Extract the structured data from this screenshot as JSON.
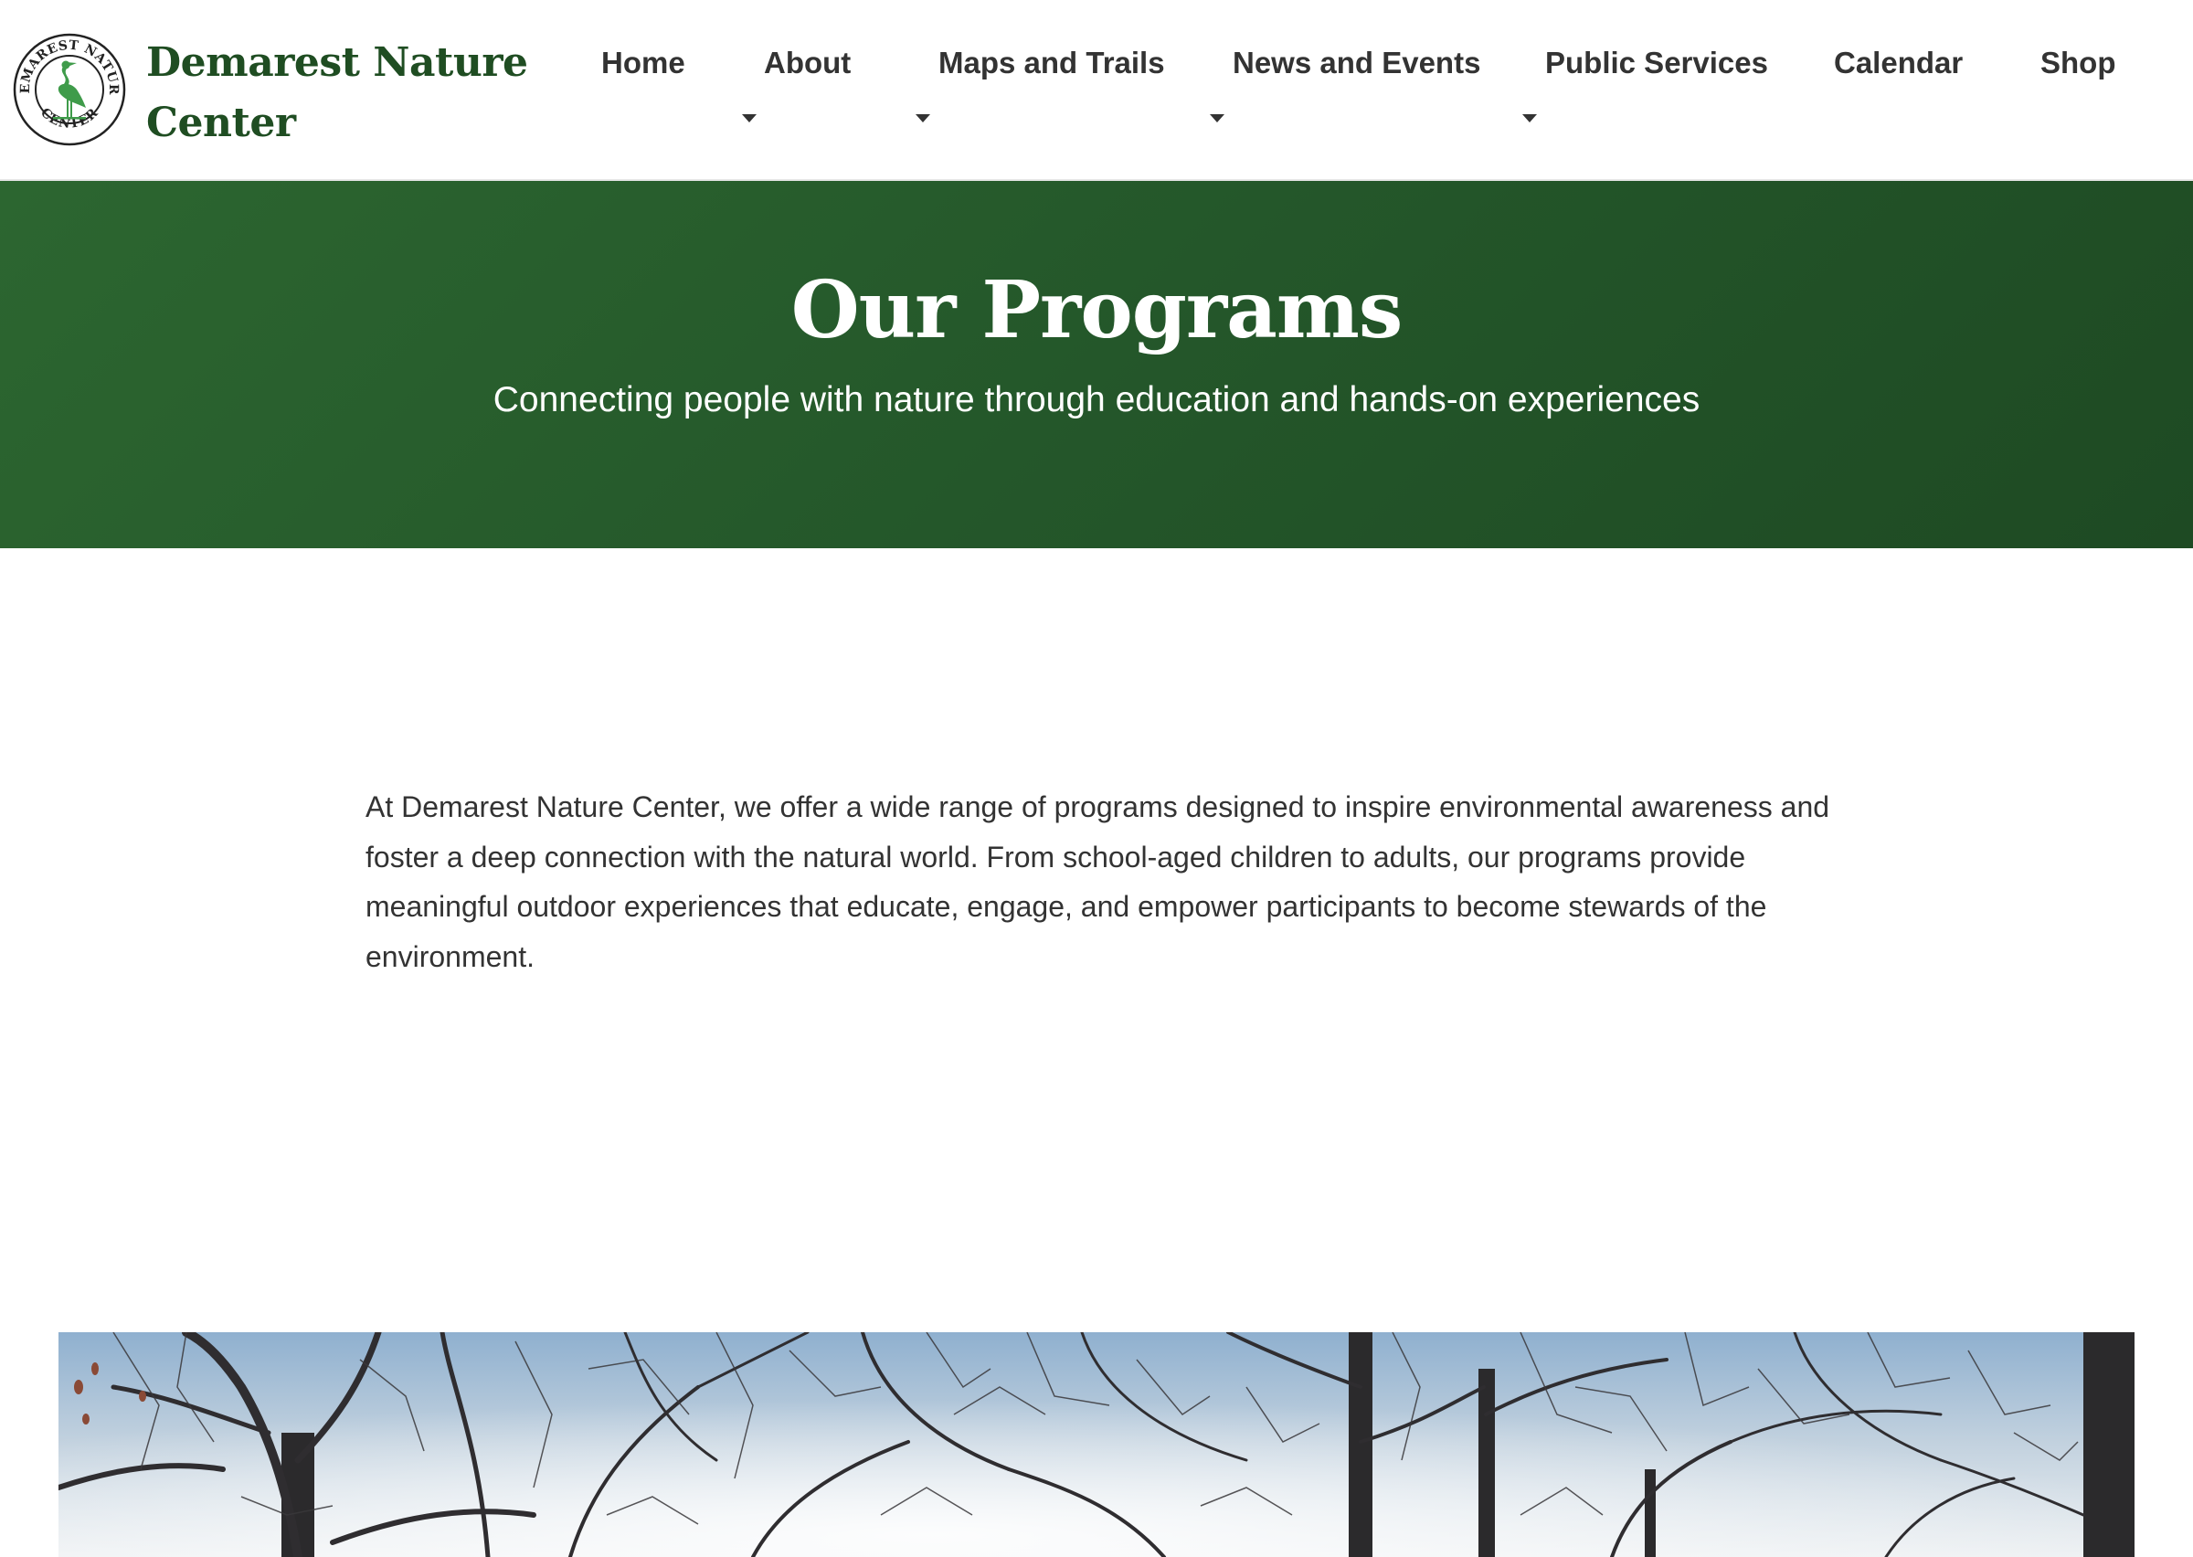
{
  "site": {
    "name": "Demarest Nature Center",
    "logo": {
      "ring_text_top": "DEMAREST NATURE",
      "ring_text_bottom": "CENTER",
      "icon": "heron-icon"
    }
  },
  "nav": {
    "items": [
      {
        "label": "Home",
        "has_dropdown": false
      },
      {
        "label": "About",
        "has_dropdown": true
      },
      {
        "label": "Maps and Trails",
        "has_dropdown": true
      },
      {
        "label": "News and Events",
        "has_dropdown": true
      },
      {
        "label": "Public Services",
        "has_dropdown": true
      },
      {
        "label": "Calendar",
        "has_dropdown": false
      },
      {
        "label": "Shop",
        "has_dropdown": false
      }
    ]
  },
  "hero": {
    "title": "Our Programs",
    "subtitle": "Connecting people with nature through education and hands-on experiences"
  },
  "intro": {
    "text": "At Demarest Nature Center, we offer a wide range of programs designed to inspire environmental awareness and foster a deep connection with the natural world. From school-aged children to adults, our programs provide meaningful outdoor experiences that educate, engage, and empower participants to become stewards of the environment."
  },
  "photo": {
    "subject": "bare winter trees against sky"
  },
  "colors": {
    "brand_green": "#1f4d22",
    "hero_green": "#24572a",
    "logo_green": "#3f9b4a",
    "nav_text": "#333333",
    "body_text": "#333333"
  }
}
